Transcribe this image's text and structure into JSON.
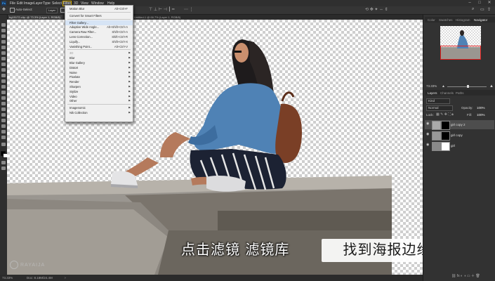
{
  "menubar": {
    "logo": "Ps",
    "items": [
      "File",
      "Edit",
      "Image",
      "Layer",
      "Type",
      "Select",
      "Filter",
      "3D",
      "View",
      "Window",
      "Help"
    ],
    "active_index": 6
  },
  "options": {
    "auto_select": "Auto-Select:",
    "layer": "Layer",
    "show_transform": "Show Transform Controls"
  },
  "document_tabs": [
    {
      "label": "bg15172-clip..@ 73.3% (Layer 1, RGB/8)",
      "active": true
    },
    {
      "label": "Untitled-1 @ 66.7% (Layer 1, RGB/8)",
      "active": false
    }
  ],
  "filter_menu": {
    "items": [
      {
        "label": "Motion Blur",
        "shortcut": "Alt+Ctrl+F",
        "enabled": true,
        "submenu": false
      },
      {
        "sep": true
      },
      {
        "label": "Convert for Smart Filters",
        "shortcut": "",
        "enabled": true,
        "submenu": false
      },
      {
        "sep": true
      },
      {
        "label": "Filter Gallery...",
        "shortcut": "",
        "enabled": true,
        "submenu": false,
        "highlight": true
      },
      {
        "label": "Adaptive Wide Angle...",
        "shortcut": "Alt+Shift+Ctrl+A",
        "enabled": true,
        "submenu": false
      },
      {
        "label": "Camera Raw Filter...",
        "shortcut": "Shift+Ctrl+A",
        "enabled": true,
        "submenu": false
      },
      {
        "label": "Lens Correction...",
        "shortcut": "Shift+Ctrl+R",
        "enabled": true,
        "submenu": false
      },
      {
        "label": "Liquify...",
        "shortcut": "Shift+Ctrl+X",
        "enabled": true,
        "submenu": false
      },
      {
        "label": "Vanishing Point...",
        "shortcut": "Alt+Ctrl+V",
        "enabled": true,
        "submenu": false
      },
      {
        "sep": true
      },
      {
        "label": "3D",
        "shortcut": "",
        "enabled": false,
        "submenu": true
      },
      {
        "label": "Blur",
        "shortcut": "",
        "enabled": true,
        "submenu": true
      },
      {
        "label": "Blur Gallery",
        "shortcut": "",
        "enabled": true,
        "submenu": true
      },
      {
        "label": "Distort",
        "shortcut": "",
        "enabled": true,
        "submenu": true
      },
      {
        "label": "Noise",
        "shortcut": "",
        "enabled": true,
        "submenu": true
      },
      {
        "label": "Pixelate",
        "shortcut": "",
        "enabled": true,
        "submenu": true
      },
      {
        "label": "Render",
        "shortcut": "",
        "enabled": true,
        "submenu": true
      },
      {
        "label": "Sharpen",
        "shortcut": "",
        "enabled": true,
        "submenu": true
      },
      {
        "label": "Stylize",
        "shortcut": "",
        "enabled": true,
        "submenu": true
      },
      {
        "label": "Video",
        "shortcut": "",
        "enabled": true,
        "submenu": true
      },
      {
        "label": "Other",
        "shortcut": "",
        "enabled": true,
        "submenu": true
      },
      {
        "sep": true
      },
      {
        "label": "Imagenomic",
        "shortcut": "",
        "enabled": true,
        "submenu": true
      },
      {
        "label": "Nik Collection",
        "shortcut": "",
        "enabled": true,
        "submenu": true
      }
    ]
  },
  "right_panel": {
    "top_tabs": [
      "Color",
      "Swatches",
      "Histogram",
      "Navigator"
    ],
    "zoom": "73.33%",
    "layer_tabs": [
      "Layers",
      "Channels",
      "Paths"
    ],
    "kind": "Kind",
    "blend": "Normal",
    "opacity_label": "Opacity:",
    "opacity": "100%",
    "lock_label": "Lock:",
    "fill_label": "Fill:",
    "fill": "100%",
    "layers": [
      {
        "name": "girl copy 2",
        "selected": true
      },
      {
        "name": "girl copy",
        "selected": false
      },
      {
        "name": "girl",
        "selected": false
      }
    ]
  },
  "statusbar": {
    "zoom": "73.33%",
    "doc": "Doc: 8.18M/24.4M"
  },
  "subtitles": {
    "left": "点击滤镜 滤镜库",
    "right": "找到海报边缘"
  },
  "watermark": "RAYAIJA",
  "colors": {
    "accent_outline": "#c8a200",
    "menu_highlight": "#d6e4f5",
    "nav_red": "#e02020"
  }
}
